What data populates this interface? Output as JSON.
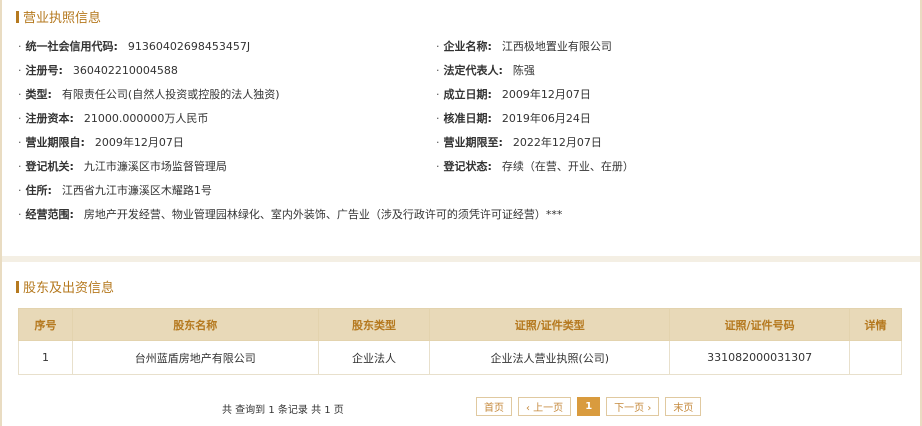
{
  "license": {
    "title": "营业执照信息",
    "fields_left": [
      {
        "label": "统一社会信用代码:",
        "value": "91360402698453457J"
      },
      {
        "label": "注册号:",
        "value": "360402210004588"
      },
      {
        "label": "类型:",
        "value": "有限责任公司(自然人投资或控股的法人独资)"
      },
      {
        "label": "注册资本:",
        "value": "21000.000000万人民币"
      },
      {
        "label": "营业期限自:",
        "value": "2009年12月07日"
      },
      {
        "label": "登记机关:",
        "value": "九江市濂溪区市场监督管理局"
      },
      {
        "label": "住所:",
        "value": "江西省九江市濂溪区木耀路1号"
      },
      {
        "label": "经营范围:",
        "value": "房地产开发经营、物业管理园林绿化、室内外装饰、广告业（涉及行政许可的须凭许可证经营）***"
      }
    ],
    "fields_right": [
      {
        "label": "企业名称:",
        "value": "江西极地置业有限公司"
      },
      {
        "label": "法定代表人:",
        "value": "陈强"
      },
      {
        "label": "成立日期:",
        "value": "2009年12月07日"
      },
      {
        "label": "核准日期:",
        "value": "2019年06月24日"
      },
      {
        "label": "营业期限至:",
        "value": "2022年12月07日"
      },
      {
        "label": "登记状态:",
        "value": "存续（在营、开业、在册）"
      }
    ]
  },
  "shareholders": {
    "title": "股东及出资信息",
    "columns": [
      "序号",
      "股东名称",
      "股东类型",
      "证照/证件类型",
      "证照/证件号码",
      "详情"
    ],
    "rows": [
      [
        "1",
        "台州蓝盾房地产有限公司",
        "企业法人",
        "企业法人营业执照(公司)",
        "331082000031307",
        ""
      ]
    ],
    "pager_info": "共 查询到 1 条记录 共 1 页",
    "pager": {
      "first": "首页",
      "prev": "‹ 上一页",
      "current": "1",
      "next": "下一页 ›",
      "last": "末页"
    }
  },
  "colors": {
    "accent": "#b5791f",
    "header_bg": "#e8d9b8",
    "current_page": "#d99b3e"
  }
}
